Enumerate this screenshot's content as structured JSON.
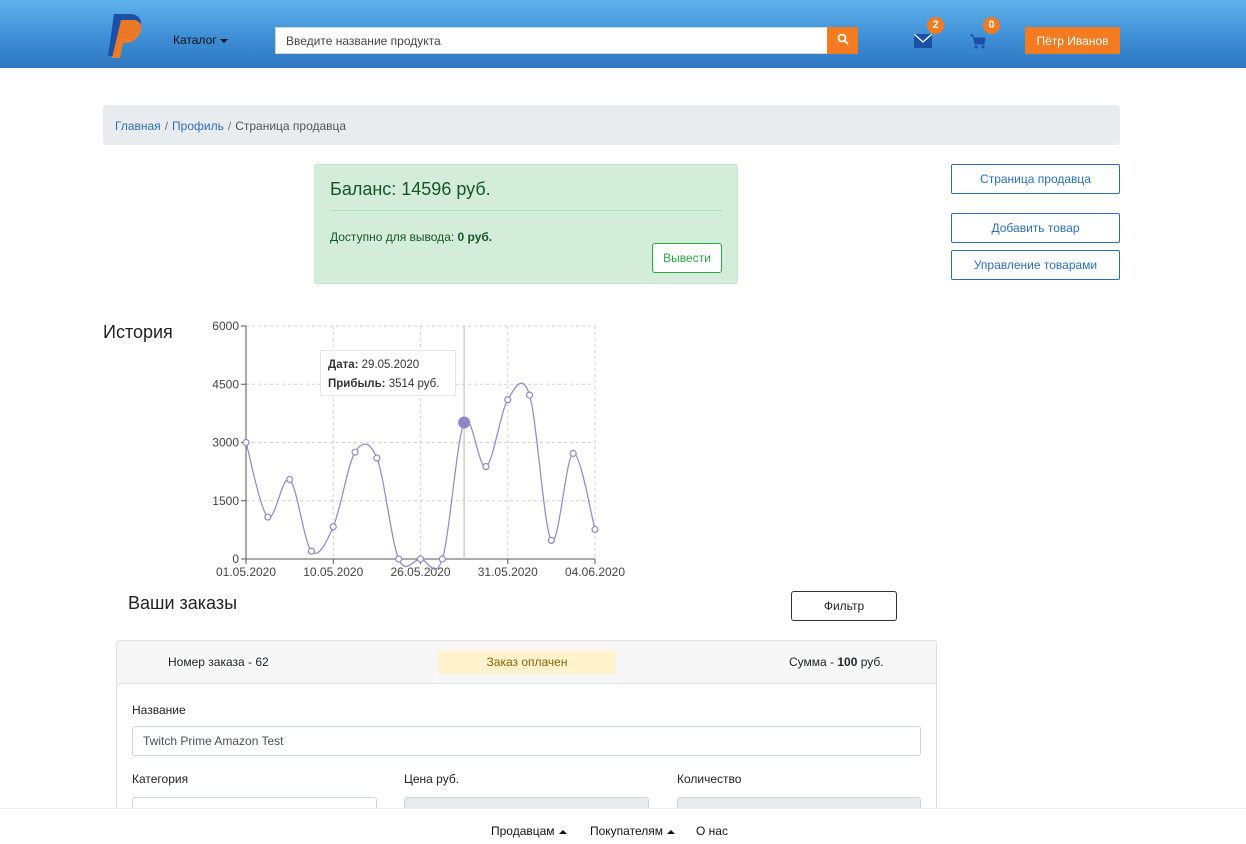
{
  "header": {
    "catalog_label": "Каталог",
    "search_placeholder": "Введите название продукта",
    "messages_count": "2",
    "cart_count": "0",
    "user_name": "Пётр Иванов",
    "accent_color": "#f47b20"
  },
  "breadcrumb": {
    "home": "Главная",
    "profile": "Профиль",
    "current": "Страница продавца"
  },
  "balance": {
    "title": "Баланс: 14596 руб.",
    "available_label": "Доступно для вывода: ",
    "available_value": "0 руб.",
    "withdraw_label": "Вывести"
  },
  "side_buttons": {
    "seller_page": "Страница продавца",
    "add_product": "Добавить товар",
    "manage_products": "Управление товарами"
  },
  "history": {
    "label": "История",
    "tooltip_date_label": "Дата:",
    "tooltip_date": " 29.05.2020",
    "tooltip_profit_label": "Прибыль:",
    "tooltip_profit": " 3514 руб."
  },
  "chart_data": {
    "type": "line",
    "title": "",
    "xlabel": "",
    "ylabel": "",
    "ylim": [
      0,
      6000
    ],
    "yticks": [
      0,
      1500,
      3000,
      4500,
      6000
    ],
    "xtick_labels": [
      "01.05.2020",
      "10.05.2020",
      "26.05.2020",
      "31.05.2020",
      "04.06.2020"
    ],
    "grid": true,
    "highlight_index": 10,
    "values": [
      3000,
      1080,
      2050,
      200,
      830,
      2750,
      2600,
      0,
      0,
      0,
      3514,
      2380,
      4100,
      4220,
      480,
      2720,
      760
    ],
    "color": "#8f86c9"
  },
  "orders": {
    "title": "Ваши заказы",
    "filter_label": "Фильтр",
    "order_number": "Номер заказа - 62",
    "status": "Заказ оплачен",
    "sum_label": "Сумма - ",
    "sum_value": "100",
    "sum_unit": " руб.",
    "name_label": "Название",
    "name_value": "Twitch Prime Amazon Test",
    "category_label": "Категория",
    "price_label": "Цена руб.",
    "quantity_label": "Количество"
  },
  "footer": {
    "sellers": "Продавцам",
    "buyers": "Покупателям",
    "about": "О нас"
  }
}
